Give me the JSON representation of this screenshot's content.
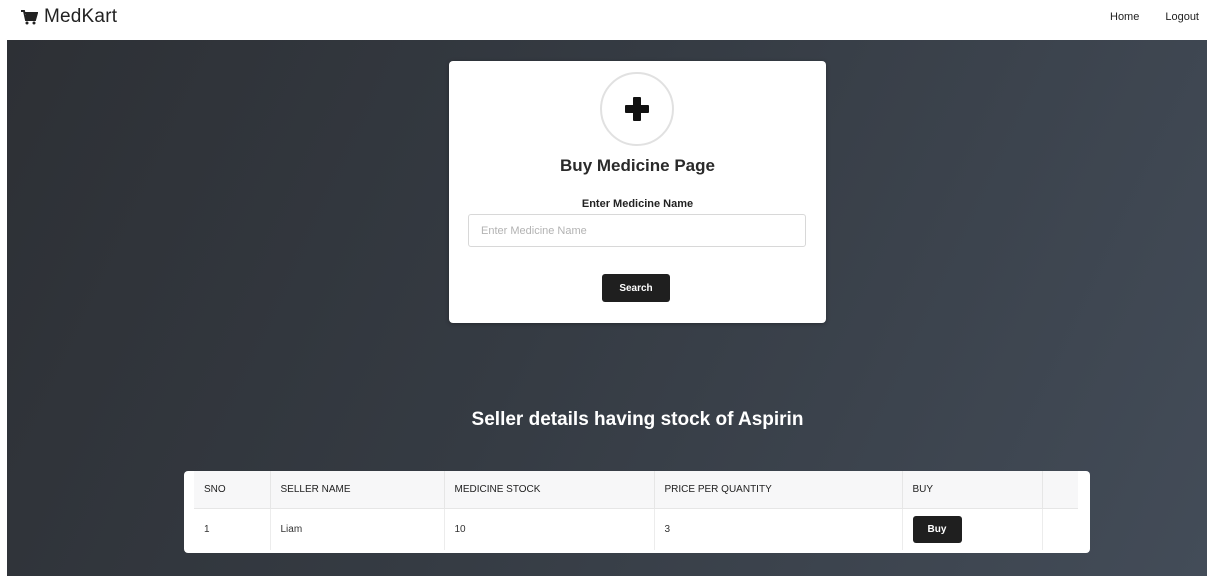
{
  "brand": {
    "name": "MedKart",
    "icon": "cart-icon"
  },
  "nav": {
    "home": "Home",
    "logout": "Logout"
  },
  "search_card": {
    "icon": "plus-icon",
    "title": "Buy Medicine Page",
    "field_label": "Enter Medicine Name",
    "input_value": "",
    "input_placeholder": "Enter Medicine Name",
    "button_label": "Search"
  },
  "results": {
    "heading": "Seller details having stock of Aspirin",
    "columns": [
      "SNO",
      "SELLER NAME",
      "MEDICINE STOCK",
      "PRICE PER QUANTITY",
      "BUY",
      ""
    ],
    "rows": [
      {
        "sno": "1",
        "seller_name": "Liam",
        "medicine_stock": "10",
        "price_per_quantity": "3",
        "buy_label": "Buy"
      }
    ]
  },
  "colors": {
    "hero_start": "#2d3035",
    "hero_end": "#434c58",
    "button": "#1f1f1f"
  }
}
